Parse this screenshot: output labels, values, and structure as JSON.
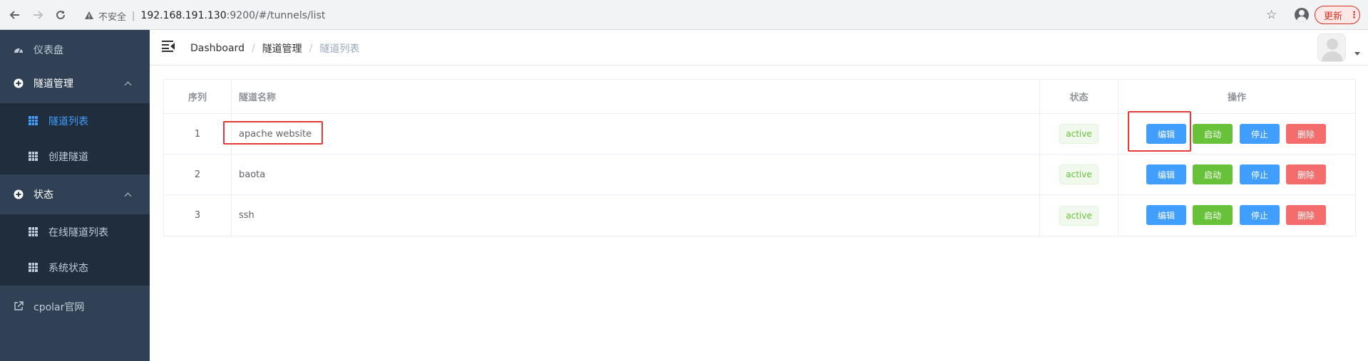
{
  "browser": {
    "insecure_label": "不安全",
    "url_host": "192.168.191.130",
    "url_path": ":9200/#/tunnels/list",
    "update_label": "更新"
  },
  "sidebar": {
    "items": [
      {
        "label": "仪表盘",
        "icon": "dashboard-icon"
      },
      {
        "label": "隧道管理",
        "icon": "plus-circle-icon",
        "expanded": true,
        "children": [
          {
            "label": "隧道列表",
            "active": true
          },
          {
            "label": "创建隧道"
          }
        ]
      },
      {
        "label": "状态",
        "icon": "plus-circle-icon",
        "expanded": true,
        "children": [
          {
            "label": "在线隧道列表"
          },
          {
            "label": "系统状态"
          }
        ]
      },
      {
        "label": "cpolar官网",
        "icon": "external-link-icon"
      }
    ]
  },
  "header": {
    "breadcrumb": [
      "Dashboard",
      "隧道管理",
      "隧道列表"
    ]
  },
  "table": {
    "headers": [
      "序列",
      "隧道名称",
      "状态",
      "操作"
    ],
    "rows": [
      {
        "index": "1",
        "name": "apache website",
        "status": "active"
      },
      {
        "index": "2",
        "name": "baota",
        "status": "active"
      },
      {
        "index": "3",
        "name": "ssh",
        "status": "active"
      }
    ],
    "actions": {
      "edit": "编辑",
      "start": "启动",
      "stop": "停止",
      "delete": "删除"
    }
  },
  "colors": {
    "sidebar_bg": "#304156",
    "submenu_bg": "#1f2d3d",
    "active_menu": "#409eff",
    "primary": "#409eff",
    "success": "#67c23a",
    "danger": "#f56c6c",
    "highlight": "#e53935"
  }
}
